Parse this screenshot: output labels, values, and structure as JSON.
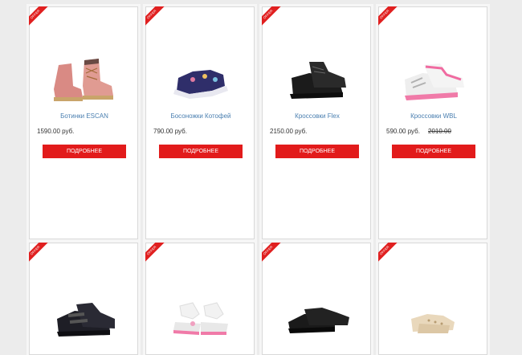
{
  "ribbon_label": "offer",
  "products": [
    {
      "name": "Ботинки ESCAN",
      "price": "1590.00 руб.",
      "old_price": "",
      "button": "ПОДРОБНЕЕ",
      "image": "pink-boots-icon"
    },
    {
      "name": "Босоножки Котофей",
      "price": "790.00 руб.",
      "old_price": "",
      "button": "ПОДРОБНЕЕ",
      "image": "navy-sandals-icon"
    },
    {
      "name": "Кроссовки Flex",
      "price": "2150.00 руб.",
      "old_price": "",
      "button": "ПОДРОБНЕЕ",
      "image": "black-sneakers-icon"
    },
    {
      "name": "Кроссовки WBL",
      "price": "590.00 руб.",
      "old_price": "2010.00",
      "button": "ПОДРОБНЕЕ",
      "image": "white-pink-sneakers-icon"
    },
    {
      "image": "black-velcro-shoes-icon"
    },
    {
      "image": "white-sandals-icon"
    },
    {
      "image": "black-loafers-icon"
    },
    {
      "image": "beige-flats-icon"
    }
  ],
  "colors": {
    "accent": "#e21b1b",
    "link": "#4a7fb0"
  }
}
